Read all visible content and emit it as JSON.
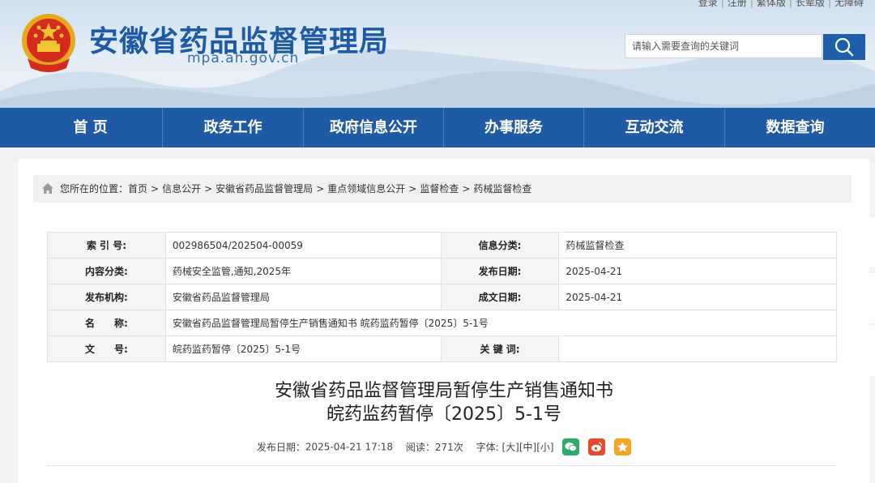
{
  "top_links": [
    "登录",
    "注册",
    "繁体版",
    "长辈版",
    "无障碍"
  ],
  "site": {
    "title": "安徽省药品监督管理局",
    "domain": "mpa.ah.gov.cn"
  },
  "search": {
    "placeholder": "请输入需要查询的关键词",
    "icon": "search-icon"
  },
  "nav": [
    "首 页",
    "政务工作",
    "政府信息公开",
    "办事服务",
    "互动交流",
    "数据查询"
  ],
  "breadcrumb": {
    "prefix": "您所在的位置：",
    "items": [
      "首页",
      "信息公开",
      "安徽省药品监督管理局",
      "重点领域信息公开",
      "监督检查",
      "药械监督检查"
    ],
    "separator": ">"
  },
  "meta": {
    "index_label": "索 引 号:",
    "index_value": "002986504/202504-00059",
    "category_label": "信息分类:",
    "category_value": "药械监督检查",
    "content_label": "内容分类:",
    "content_value": "药械安全监管,通知,2025年",
    "pubdate_label": "发布日期:",
    "pubdate_value": "2025-04-21",
    "org_label": "发布机构:",
    "org_value": "安徽省药品监督管理局",
    "docdate_label": "成文日期:",
    "docdate_value": "2025-04-21",
    "name_label": "名　　称:",
    "name_value": "安徽省药品监督管理局暂停生产销售通知书 皖药监药暂停〔2025〕5-1号",
    "docno_label": "文　　号:",
    "docno_value": "皖药监药暂停〔2025〕5-1号",
    "keywords_label": "关 键 词:",
    "keywords_value": ""
  },
  "article": {
    "title_line1": "安徽省药品监督管理局暂停生产销售通知书",
    "title_line2": "皖药监药暂停〔2025〕5-1号",
    "pub_label": "发布日期：",
    "pub_value": "2025-04-21 17:18",
    "views_label": "阅读：",
    "views_value": "271次",
    "font_label": "字体:",
    "font_large": "[大]",
    "font_medium": "[中]",
    "font_small": "[小]"
  },
  "colors": {
    "brand": "#1f5aa4",
    "wechat": "#2aae67",
    "weibo": "#e6492d",
    "favorite": "#f5a623"
  }
}
